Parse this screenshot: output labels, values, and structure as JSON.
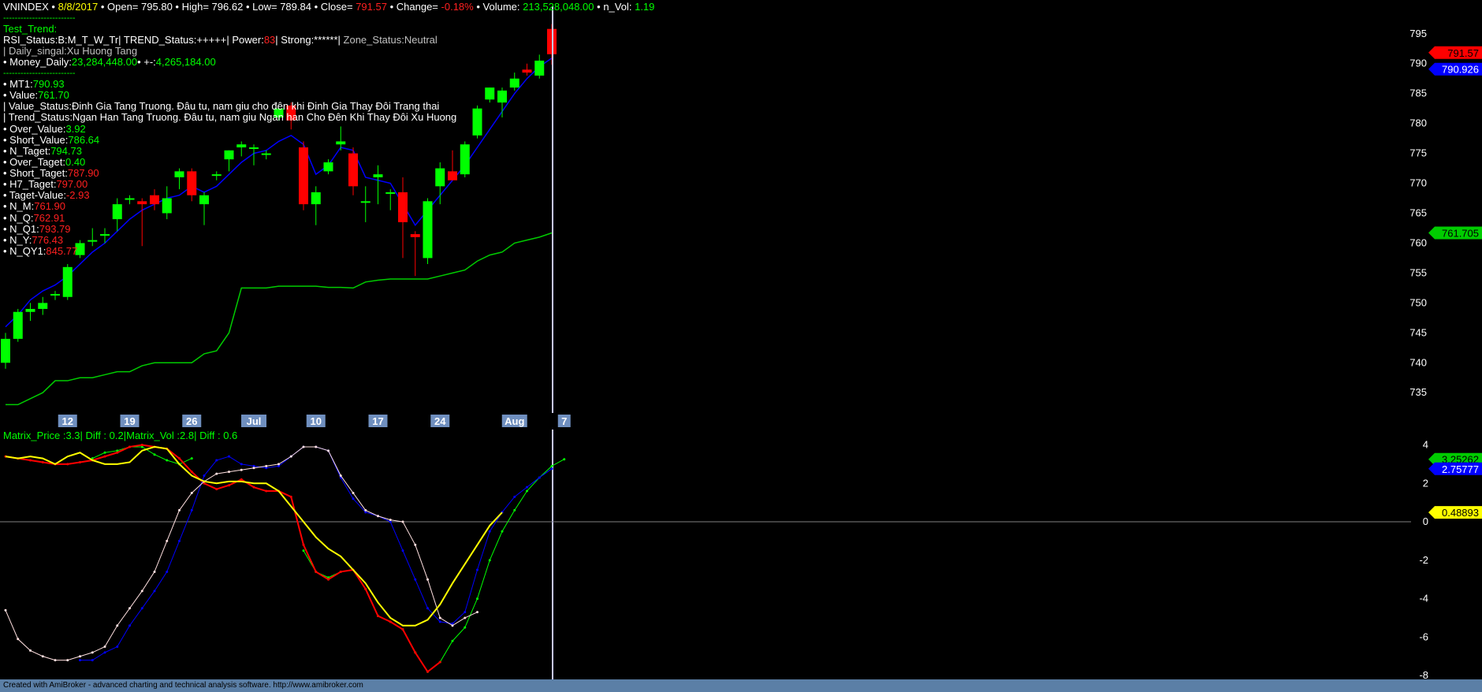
{
  "header": {
    "symbol": "VNINDEX",
    "date": "8/8/2017",
    "open_label": "Open=",
    "open": "795.80",
    "high_label": "High=",
    "high": "796.62",
    "low_label": "Low=",
    "low": "789.84",
    "close_label": "Close=",
    "close": "791.57",
    "change_label": "Change=",
    "change": "-0.18%",
    "volume_label": "Volume:",
    "volume": "213,528,048.00",
    "nvol_label": "n_Vol:",
    "nvol": "1.19",
    "sep1": "-------------------------"
  },
  "info": {
    "test_trend": "Test_Trend:",
    "rsi_line_a": "RSI_Status:B:M_T_W_Tr| TREND_Status:+++++| Power:",
    "power": "83",
    "rsi_line_b": "| Strong:******| ",
    "zone": "Zone_Status:Neutral",
    "daily_signal": "| Daily_singal:Xu Huong Tang",
    "money_label": "• Money_Daily:",
    "money": "23,284,448.00",
    "money_diff_label": "• +-:",
    "money_diff": "4,265,184.00",
    "sep2": "-------------------------",
    "mt1_label": "• MT1:",
    "mt1": "790.93",
    "value_label": "• Value:",
    "value": "761.70",
    "value_status": "| Value_Status:Đinh Gia Tang Truong. Đâu tu, nam giu cho đên khi Đinh Gia Thay Đôi Trang thai",
    "trend_status": "| Trend_Status:Ngan Han Tang Truong. Đâu tu, nam giu Ngan han Cho Đên Khi Thay Đôi Xu Huong",
    "over_value_label": "• Over_Value:",
    "over_value": "3.92",
    "short_value_label": "• Short_Value:",
    "short_value": "786.64",
    "n_taget_label": "• N_Taget:",
    "n_taget": "794.73",
    "over_taget_label": "• Over_Taget:",
    "over_taget": "0.40",
    "short_taget_label": "• Short_Taget:",
    "short_taget": "787.90",
    "h7_taget_label": "• H7_Taget:",
    "h7_taget": "797.00",
    "taget_value_label": "• Taget-Value:",
    "taget_value": "-2.93",
    "n_m_label": "• N_M:",
    "n_m": "761.90",
    "n_q_label": "• N_Q:",
    "n_q": "762.91",
    "n_q1_label": "• N_Q1:",
    "n_q1": "793.79",
    "n_y_label": "• N_Y:",
    "n_y": "776.43",
    "n_qy1_label": "• N_QY1:",
    "n_qy1": "845.77"
  },
  "indicator_title": {
    "matrix_price": "Matrix_Price :3.3|",
    "diff1": "Diff : 0.2|",
    "matrix_vol": "Matrix_Vol :2.8|",
    "diff2": "Diff : 0.6"
  },
  "price_tags": {
    "close": "791.57",
    "ma": "790.926",
    "value_line": "761.705"
  },
  "indicator_tags": {
    "green": "3.25262",
    "blue": "2.75777",
    "yellow": "0.48893"
  },
  "footer": {
    "text": "Created with AmiBroker - advanced charting and technical analysis software. http://www.amibroker.com"
  },
  "colors": {
    "bull": "#00ff00",
    "bear": "#ff0000",
    "ma": "#0000ff",
    "value": "#00cc00",
    "cursor": "#c8c8ff",
    "axis_text": "#ffffff",
    "date_bg": "#6f8fbf"
  },
  "chart_data": [
    {
      "type": "candlestick",
      "title": "VNINDEX",
      "ylim": [
        732,
        798
      ],
      "yticks": [
        735,
        740,
        745,
        750,
        755,
        760,
        765,
        770,
        775,
        780,
        785,
        790,
        795
      ],
      "xticks": [
        "12",
        "19",
        "26",
        "Jul",
        "10",
        "17",
        "24",
        "Aug",
        "7"
      ],
      "xtick_index": [
        5,
        10,
        15,
        20,
        25,
        30,
        35,
        41,
        45
      ],
      "ohlc": [
        [
          740.0,
          745.0,
          739.0,
          744.0
        ],
        [
          744.0,
          749.0,
          743.5,
          748.5
        ],
        [
          748.5,
          750.0,
          747.0,
          749.0
        ],
        [
          749.0,
          751.0,
          748.0,
          750.0
        ],
        [
          751.5,
          752.0,
          750.5,
          751.5
        ],
        [
          751.0,
          756.5,
          750.5,
          756.0
        ],
        [
          758.0,
          760.5,
          757.5,
          760.0
        ],
        [
          760.5,
          762.5,
          759.5,
          760.5
        ],
        [
          761.5,
          762.5,
          760.0,
          761.5
        ],
        [
          764.0,
          767.5,
          762.0,
          766.5
        ],
        [
          767.5,
          768.0,
          766.5,
          767.5
        ],
        [
          767.0,
          767.5,
          759.5,
          766.5
        ],
        [
          768.0,
          769.0,
          765.5,
          766.5
        ],
        [
          765.0,
          769.5,
          764.0,
          767.5
        ],
        [
          771.0,
          772.5,
          769.0,
          772.0
        ],
        [
          772.0,
          772.5,
          767.0,
          768.0
        ],
        [
          766.5,
          768.5,
          763.0,
          768.0
        ],
        [
          771.5,
          772.0,
          770.5,
          771.5
        ],
        [
          774.0,
          775.5,
          772.0,
          775.5
        ],
        [
          776.0,
          777.0,
          774.5,
          776.5
        ],
        [
          776.0,
          776.5,
          773.0,
          776.0
        ],
        [
          775.0,
          775.5,
          774.0,
          775.0
        ],
        [
          781.0,
          782.5,
          780.5,
          782.5
        ],
        [
          783.0,
          783.5,
          779.0,
          780.5
        ],
        [
          776.0,
          777.0,
          765.5,
          766.5
        ],
        [
          766.5,
          769.5,
          763.0,
          768.5
        ],
        [
          772.0,
          774.0,
          771.5,
          773.5
        ],
        [
          776.5,
          779.5,
          775.5,
          777.0
        ],
        [
          775.0,
          776.0,
          768.0,
          769.5
        ],
        [
          767.0,
          769.5,
          763.5,
          767.0
        ],
        [
          771.0,
          773.0,
          766.5,
          771.5
        ],
        [
          768.5,
          769.0,
          765.5,
          768.5
        ],
        [
          768.5,
          771.0,
          757.5,
          763.5
        ],
        [
          761.5,
          762.0,
          754.5,
          761.0
        ],
        [
          757.5,
          767.5,
          756.5,
          767.0
        ],
        [
          769.5,
          773.5,
          766.5,
          772.5
        ],
        [
          772.0,
          775.5,
          770.5,
          770.5
        ],
        [
          771.5,
          777.0,
          771.0,
          776.5
        ],
        [
          778.0,
          783.0,
          777.5,
          782.5
        ],
        [
          784.0,
          786.0,
          783.5,
          786.0
        ],
        [
          783.5,
          786.0,
          781.0,
          785.5
        ],
        [
          786.0,
          788.5,
          785.5,
          787.5
        ],
        [
          789.0,
          790.0,
          788.0,
          788.5
        ],
        [
          788.0,
          791.5,
          787.5,
          790.5
        ],
        [
          795.8,
          796.62,
          789.84,
          791.57
        ]
      ],
      "ma": [
        746.0,
        748.0,
        750.5,
        752.0,
        753.0,
        754.5,
        756.5,
        758.5,
        760.0,
        762.0,
        764.0,
        765.5,
        766.5,
        767.5,
        768.0,
        769.5,
        768.5,
        769.5,
        771.5,
        773.5,
        775.0,
        775.5,
        777.0,
        778.0,
        776.5,
        771.5,
        773.0,
        776.0,
        775.5,
        771.0,
        770.5,
        770.0,
        766.5,
        763.0,
        765.5,
        768.0,
        770.5,
        773.0,
        776.0,
        779.0,
        782.0,
        785.0,
        787.5,
        789.5,
        790.926
      ],
      "value_line": [
        733.0,
        733.0,
        734.0,
        735.0,
        737.0,
        737.0,
        737.5,
        737.5,
        738.0,
        738.5,
        738.5,
        739.5,
        740.0,
        740.0,
        740.0,
        740.0,
        741.5,
        742.0,
        745.0,
        752.5,
        752.5,
        752.5,
        752.8,
        752.8,
        752.8,
        752.8,
        752.6,
        752.6,
        752.5,
        753.5,
        753.8,
        754.0,
        754.0,
        754.0,
        754.0,
        754.5,
        755.0,
        755.5,
        757.0,
        758.0,
        758.5,
        760.0,
        760.5,
        761.0,
        761.705
      ]
    },
    {
      "type": "line",
      "title": "Matrix_Price / Matrix_Vol",
      "ylim": [
        -8.2,
        4.8
      ],
      "yticks": [
        4,
        2,
        0,
        -2,
        -4,
        -6,
        -8
      ],
      "series": [
        {
          "name": "Matrix_Price",
          "color": "#00ff00",
          "values": [
            null,
            null,
            null,
            null,
            null,
            null,
            null,
            3.3,
            3.6,
            3.7,
            3.9,
            3.9,
            3.5,
            3.2,
            3.0,
            3.3,
            null,
            null,
            null,
            null,
            null,
            null,
            null,
            null,
            -1.5,
            -2.6,
            -2.9,
            -2.6,
            -2.5,
            -3.5,
            -4.9,
            -5.2,
            -5.6,
            -6.8,
            -7.8,
            -7.3,
            -6.2,
            -5.5,
            -4.0,
            -2.0,
            -0.5,
            0.6,
            1.6,
            2.3,
            2.9,
            3.25262
          ]
        },
        {
          "name": "Matrix_Vol",
          "color": "#ff0000",
          "values": [
            3.4,
            3.3,
            3.2,
            3.1,
            3.0,
            3.0,
            3.1,
            3.2,
            3.4,
            3.6,
            3.9,
            4.0,
            3.9,
            3.8,
            3.3,
            2.6,
            2.0,
            1.7,
            1.9,
            2.2,
            1.8,
            1.6,
            1.6,
            1.3,
            -1.2,
            -2.6,
            -3.0,
            -2.6,
            -2.5,
            -3.5,
            -4.9,
            -5.2,
            -5.6,
            -6.8,
            -7.8,
            -7.3,
            null,
            null,
            null,
            null,
            null,
            null,
            null,
            null,
            null,
            null
          ]
        },
        {
          "name": "Blue",
          "color": "#0000ff",
          "values": [
            null,
            null,
            null,
            null,
            null,
            null,
            -7.2,
            -7.2,
            -6.8,
            -6.5,
            -5.4,
            -4.5,
            -3.6,
            -2.6,
            -1.0,
            0.6,
            2.4,
            3.2,
            3.4,
            3.0,
            2.9,
            2.8,
            2.9,
            3.4,
            3.9,
            3.9,
            3.7,
            2.3,
            1.2,
            0.5,
            0.3,
            0.0,
            -1.5,
            -3.0,
            -4.5,
            -5.2,
            -5.3,
            -4.7,
            -2.5,
            -0.5,
            0.5,
            1.3,
            1.8,
            2.3,
            2.75777
          ]
        },
        {
          "name": "Pink",
          "color": "#ffe0e0",
          "values": [
            -4.6,
            -6.1,
            -6.7,
            -7.0,
            -7.2,
            -7.2,
            -7.0,
            -6.8,
            -6.5,
            -5.4,
            -4.5,
            -3.6,
            -2.6,
            -1.0,
            0.6,
            1.5,
            2.1,
            2.5,
            2.6,
            2.7,
            2.8,
            2.9,
            3.0,
            3.4,
            3.9,
            3.9,
            3.7,
            2.4,
            1.5,
            0.6,
            0.3,
            0.1,
            0.0,
            -1.2,
            -3.0,
            -5.0,
            -5.4,
            -5.0,
            -4.7,
            null,
            null,
            null,
            null,
            null,
            null
          ]
        },
        {
          "name": "Yellow",
          "color": "#ffff00",
          "values": [
            3.4,
            3.3,
            3.4,
            3.3,
            3.0,
            3.4,
            3.6,
            3.2,
            3.0,
            3.0,
            3.1,
            3.7,
            3.9,
            3.8,
            3.0,
            2.4,
            2.1,
            2.0,
            2.1,
            2.1,
            2.0,
            2.0,
            1.6,
            0.8,
            0.0,
            -0.8,
            -1.4,
            -1.8,
            -2.5,
            -3.2,
            -4.2,
            -5.0,
            -5.4,
            -5.4,
            -5.1,
            -4.3,
            -3.2,
            -2.2,
            -1.2,
            -0.2,
            0.48893
          ]
        }
      ]
    }
  ]
}
